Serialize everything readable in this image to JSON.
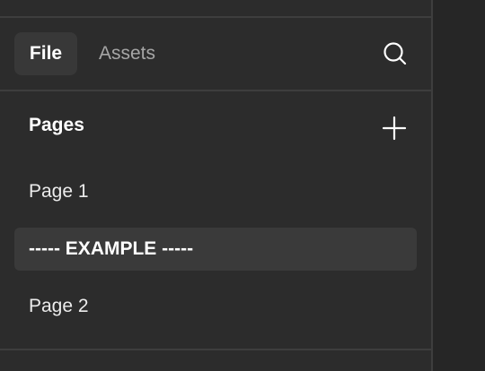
{
  "tabs": [
    {
      "label": "File",
      "active": true
    },
    {
      "label": "Assets",
      "active": false
    }
  ],
  "search": {
    "icon": "search-icon"
  },
  "pages": {
    "title": "Pages",
    "add_icon": "plus-icon",
    "items": [
      {
        "label": "Page 1",
        "selected": false
      },
      {
        "label": "----- EXAMPLE -----",
        "selected": true
      },
      {
        "label": "Page 2",
        "selected": false
      }
    ]
  },
  "colors": {
    "panel_bg": "#2c2c2c",
    "canvas_bg": "#262626",
    "selected_bg": "#3a3a3a",
    "active_tab_bg": "#383838",
    "divider": "#3e3e3e",
    "text_primary": "#ffffff",
    "text_secondary": "#a6a6a6"
  }
}
